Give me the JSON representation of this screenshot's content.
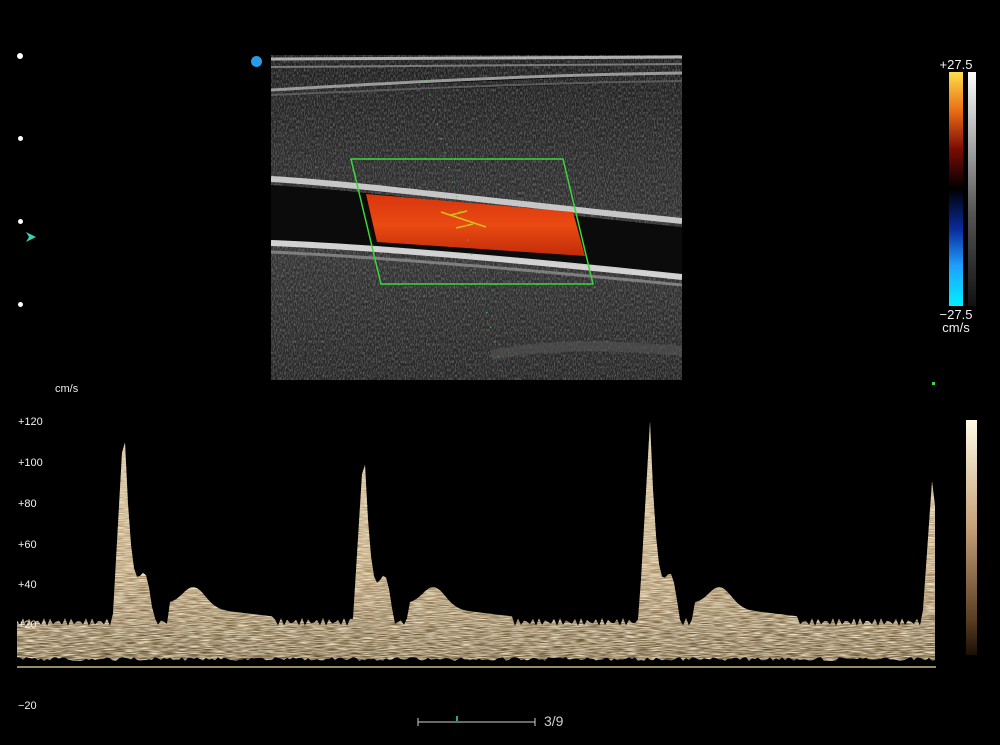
{
  "color_scale": {
    "top_label": "+27.5",
    "bottom_label": "−27.5",
    "unit": "cm/s",
    "colors": [
      "#ffe04a",
      "#e86a12",
      "#7a0b05",
      "#000000",
      "#0a2a9a",
      "#1ea0ff",
      "#00f0ff"
    ]
  },
  "doppler_trace": {
    "unit": "cm/s",
    "y_ticks": [
      "+120",
      "+100",
      "+80",
      "+60",
      "+40",
      "+20",
      "−20"
    ],
    "tick_values": [
      120,
      100,
      80,
      60,
      40,
      20,
      -20
    ],
    "baseline_color": "#f0e29a",
    "spectrum_color": "#e9d3a4"
  },
  "frame_counter": "3/9",
  "icons": {
    "orientation": "orientation-dot-icon",
    "focus": "focus-marker-icon"
  },
  "colors": {
    "doppler_box": "#3cd63c",
    "flow": "#e63c12",
    "orientation_dot": "#2a9be3",
    "focus_marker": "#39d3b4"
  }
}
